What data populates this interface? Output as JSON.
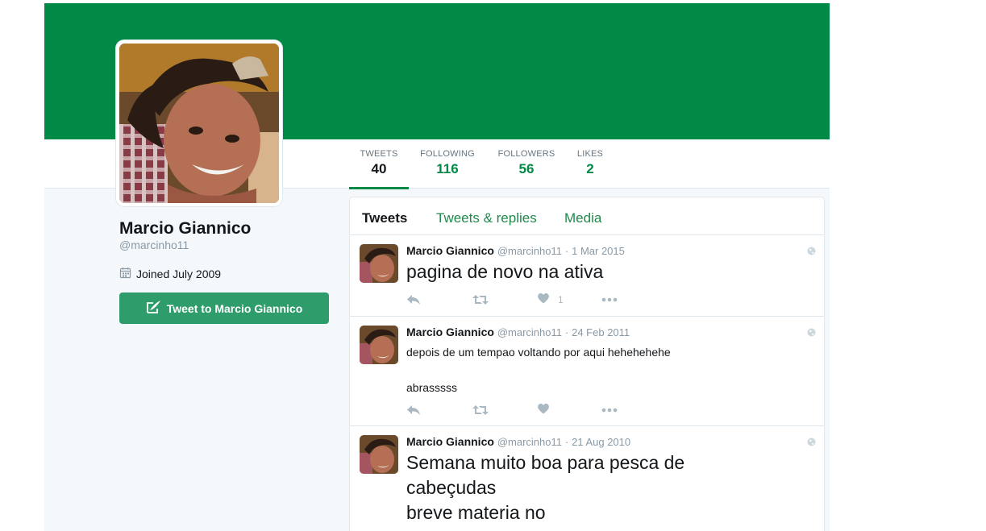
{
  "profile": {
    "name": "Marcio Giannico",
    "handle": "@marcinho11",
    "joined": "Joined July 2009",
    "tweet_to_label": "Tweet to Marcio Giannico",
    "banner_color": "#008a45"
  },
  "stats": [
    {
      "label": "TWEETS",
      "value": "40"
    },
    {
      "label": "FOLLOWING",
      "value": "116"
    },
    {
      "label": "FOLLOWERS",
      "value": "56"
    },
    {
      "label": "LIKES",
      "value": "2"
    }
  ],
  "tabs": [
    "Tweets",
    "Tweets & replies",
    "Media"
  ],
  "tweets": [
    {
      "name": "Marcio Giannico",
      "handle": "@marcinho11",
      "date": "1 Mar 2015",
      "lines": [
        "pagina de novo na ativa"
      ],
      "likes": "1"
    },
    {
      "name": "Marcio Giannico",
      "handle": "@marcinho11",
      "date": "24 Feb 2011",
      "lines": [
        "depois de um tempao voltando por aqui hehehehehe",
        "",
        "abrasssss"
      ],
      "likes": ""
    },
    {
      "name": "Marcio Giannico",
      "handle": "@marcinho11",
      "date": "21 Aug 2010",
      "lines": [
        "Semana muito boa para pesca de",
        "cabeçudas",
        "breve materia no"
      ],
      "likes": ""
    }
  ],
  "icons": {
    "calendar": "calendar-icon",
    "compose": "compose-icon",
    "reply": "reply-icon",
    "retweet": "retweet-icon",
    "like": "heart-icon",
    "more": "more-icon",
    "globe": "globe-icon"
  }
}
